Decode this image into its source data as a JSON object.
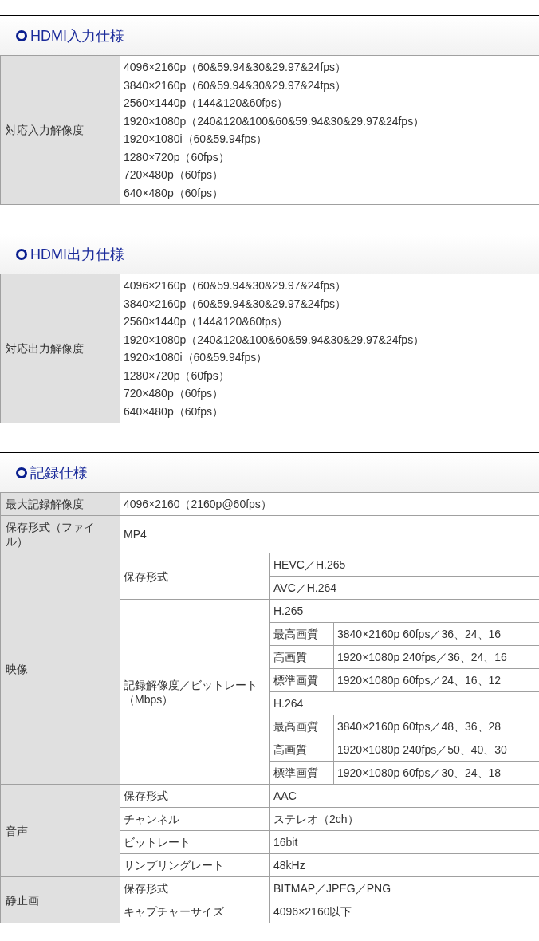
{
  "sections": [
    {
      "title": "HDMI入力仕様",
      "kind": "list",
      "rows": [
        {
          "label": "対応入力解像度",
          "lines": [
            "4096×2160p（60&59.94&30&29.97&24fps）",
            "3840×2160p（60&59.94&30&29.97&24fps）",
            "2560×1440p（144&120&60fps）",
            "1920×1080p（240&120&100&60&59.94&30&29.97&24fps）",
            "1920×1080i（60&59.94fps）",
            "1280×720p（60fps）",
            "720×480p（60fps）",
            "640×480p（60fps）"
          ]
        }
      ]
    },
    {
      "title": "HDMI出力仕様",
      "kind": "list",
      "rows": [
        {
          "label": "対応出力解像度",
          "lines": [
            "4096×2160p（60&59.94&30&29.97&24fps）",
            "3840×2160p（60&59.94&30&29.97&24fps）",
            "2560×1440p（144&120&60fps）",
            "1920×1080p（240&120&100&60&59.94&30&29.97&24fps）",
            "1920×1080i（60&59.94fps）",
            "1280×720p（60fps）",
            "720×480p（60fps）",
            "640×480p（60fps）"
          ]
        }
      ]
    },
    {
      "title": "記録仕様",
      "kind": "grid",
      "rows": [
        {
          "label": "最大記録解像度",
          "value": "4096×2160（2160p@60fps）"
        },
        {
          "label": "保存形式（ファイル）",
          "value": "MP4"
        },
        {
          "label": "映像",
          "groups": [
            {
              "label": "保存形式",
              "values": [
                "HEVC／H.265",
                "AVC／H.264"
              ]
            },
            {
              "label": "記録解像度／ビットレート（Mbps）",
              "codecs": [
                {
                  "name": "H.265",
                  "qualities": [
                    {
                      "label": "最高画質",
                      "value": "3840×2160p 60fps／36、24、16"
                    },
                    {
                      "label": "高画質",
                      "value": "1920×1080p 240fps／36、24、16"
                    },
                    {
                      "label": "標準画質",
                      "value": "1920×1080p 60fps／24、16、12"
                    }
                  ]
                },
                {
                  "name": "H.264",
                  "qualities": [
                    {
                      "label": "最高画質",
                      "value": "3840×2160p 60fps／48、36、28"
                    },
                    {
                      "label": "高画質",
                      "value": "1920×1080p 240fps／50、40、30"
                    },
                    {
                      "label": "標準画質",
                      "value": "1920×1080p 60fps／30、24、18"
                    }
                  ]
                }
              ]
            }
          ]
        },
        {
          "label": "音声",
          "groups": [
            {
              "label": "保存形式",
              "values": [
                "AAC"
              ]
            },
            {
              "label": "チャンネル",
              "values": [
                "ステレオ（2ch）"
              ]
            },
            {
              "label": "ビットレート",
              "values": [
                "16bit"
              ]
            },
            {
              "label": "サンプリングレート",
              "values": [
                "48kHz"
              ]
            }
          ]
        },
        {
          "label": "静止画",
          "groups": [
            {
              "label": "保存形式",
              "values": [
                "BITMAP／JPEG／PNG"
              ]
            },
            {
              "label": "キャプチャーサイズ",
              "values": [
                "4096×2160以下"
              ]
            }
          ]
        }
      ]
    }
  ]
}
